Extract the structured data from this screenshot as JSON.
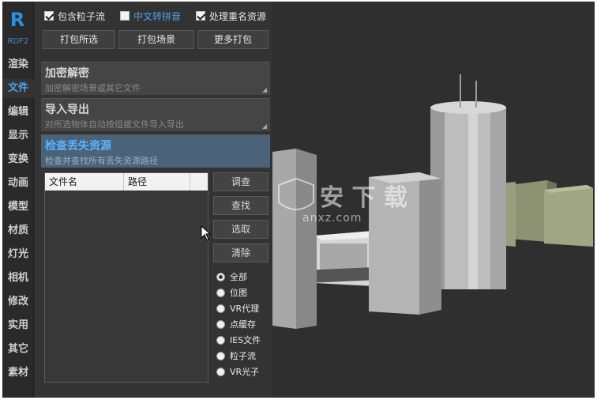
{
  "app": {
    "logo": "R",
    "version": "RDF2"
  },
  "nav": {
    "items": [
      {
        "label": "渲染",
        "active": false
      },
      {
        "label": "文件",
        "active": true
      },
      {
        "label": "编辑",
        "active": false
      },
      {
        "label": "显示",
        "active": false
      },
      {
        "label": "变换",
        "active": false
      },
      {
        "label": "动画",
        "active": false
      },
      {
        "label": "模型",
        "active": false
      },
      {
        "label": "材质",
        "active": false
      },
      {
        "label": "灯光",
        "active": false
      },
      {
        "label": "相机",
        "active": false
      },
      {
        "label": "修改",
        "active": false
      },
      {
        "label": "实用",
        "active": false
      },
      {
        "label": "其它",
        "active": false
      },
      {
        "label": "素材",
        "active": false
      }
    ]
  },
  "options": {
    "include_particles": {
      "label": "包含粒子流",
      "checked": true
    },
    "chinese_pinyin": {
      "label": "中文转拼音",
      "checked": false
    },
    "rename_duplicates": {
      "label": "处理重名资源",
      "checked": true
    }
  },
  "pack_buttons": {
    "pack_selected": "打包所选",
    "pack_scene": "打包场景",
    "more_pack": "更多打包"
  },
  "sections": {
    "encrypt": {
      "title": "加密解密",
      "desc": "加密解密场景或其它文件"
    },
    "import_export": {
      "title": "导入导出",
      "desc": "对所选物体自动按组拔文件导入导出"
    },
    "missing": {
      "title": "检查丢失资源",
      "desc": "检查并查找所有丢失资源路径"
    }
  },
  "file_table": {
    "columns": [
      "文件名",
      "路径"
    ],
    "rows": []
  },
  "side_buttons": {
    "check": "调查",
    "find": "查找",
    "select": "选取",
    "clear": "清除"
  },
  "filters": {
    "selected": "全部",
    "items": [
      "全部",
      "位图",
      "VR代理",
      "点缓存",
      "IES文件",
      "粒子流",
      "VR光子"
    ]
  },
  "watermark": {
    "text": "anxz.com"
  },
  "colors": {
    "accent": "#4aa3f0",
    "panel": "#343434",
    "viewport": "#2f2f2f"
  }
}
